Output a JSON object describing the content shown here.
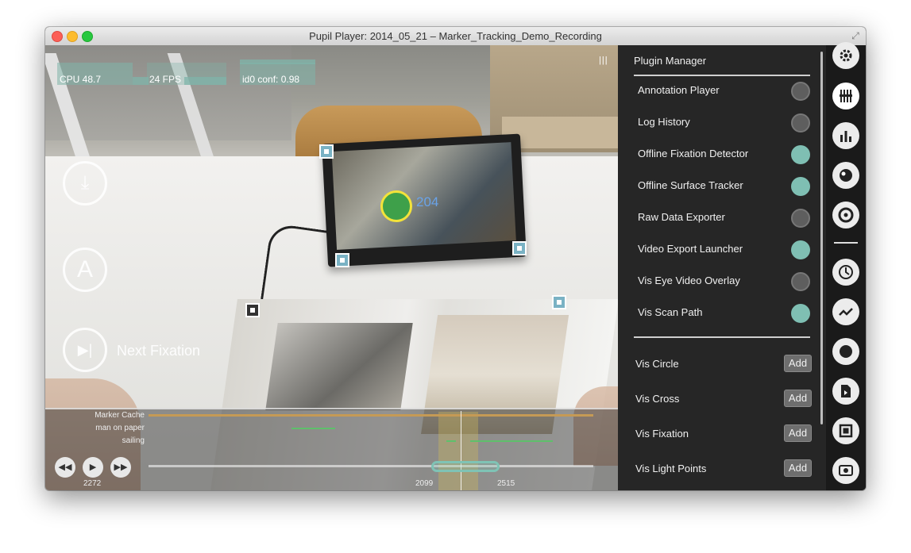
{
  "window": {
    "title": "Pupil Player: 2014_05_21 – Marker_Tracking_Demo_Recording"
  },
  "stats": {
    "cpu": "CPU 48.7",
    "fps": "24 FPS",
    "conf": "id0 conf: 0.98"
  },
  "video": {
    "fixation_id": "204"
  },
  "controls": {
    "a_label": "A",
    "next_fixation": "Next Fixation"
  },
  "timeline": {
    "rows": [
      "Marker Cache",
      "man on paper",
      "sailing"
    ],
    "start_frame": "2272",
    "trim_start": "2099",
    "trim_end": "2515"
  },
  "plugin_manager": {
    "title": "Plugin Manager",
    "plugins": [
      {
        "label": "Annotation Player",
        "enabled": false
      },
      {
        "label": "Log History",
        "enabled": false
      },
      {
        "label": "Offline Fixation Detector",
        "enabled": true
      },
      {
        "label": "Offline Surface Tracker",
        "enabled": true
      },
      {
        "label": "Raw Data Exporter",
        "enabled": false
      },
      {
        "label": "Video Export Launcher",
        "enabled": true
      },
      {
        "label": "Vis Eye Video Overlay",
        "enabled": false
      },
      {
        "label": "Vis Scan Path",
        "enabled": true
      }
    ],
    "addable": [
      {
        "label": "Vis Circle",
        "button": "Add"
      },
      {
        "label": "Vis Cross",
        "button": "Add"
      },
      {
        "label": "Vis Fixation",
        "button": "Add"
      },
      {
        "label": "Vis Light Points",
        "button": "Add"
      }
    ]
  },
  "rail_icons": [
    "gear-icon",
    "plugin-sliders-icon",
    "bar-chart-icon",
    "eye-icon",
    "target-icon",
    "clock-icon",
    "scan-path-icon",
    "circle-icon",
    "export-file-icon",
    "surface-frame-icon",
    "eye-overlay-icon"
  ],
  "colors": {
    "toggle_on": "#7fbfb3",
    "gaze": "#3ea04a",
    "gaze_ring": "#f3e33a",
    "cache_bar": "#c59a55"
  }
}
